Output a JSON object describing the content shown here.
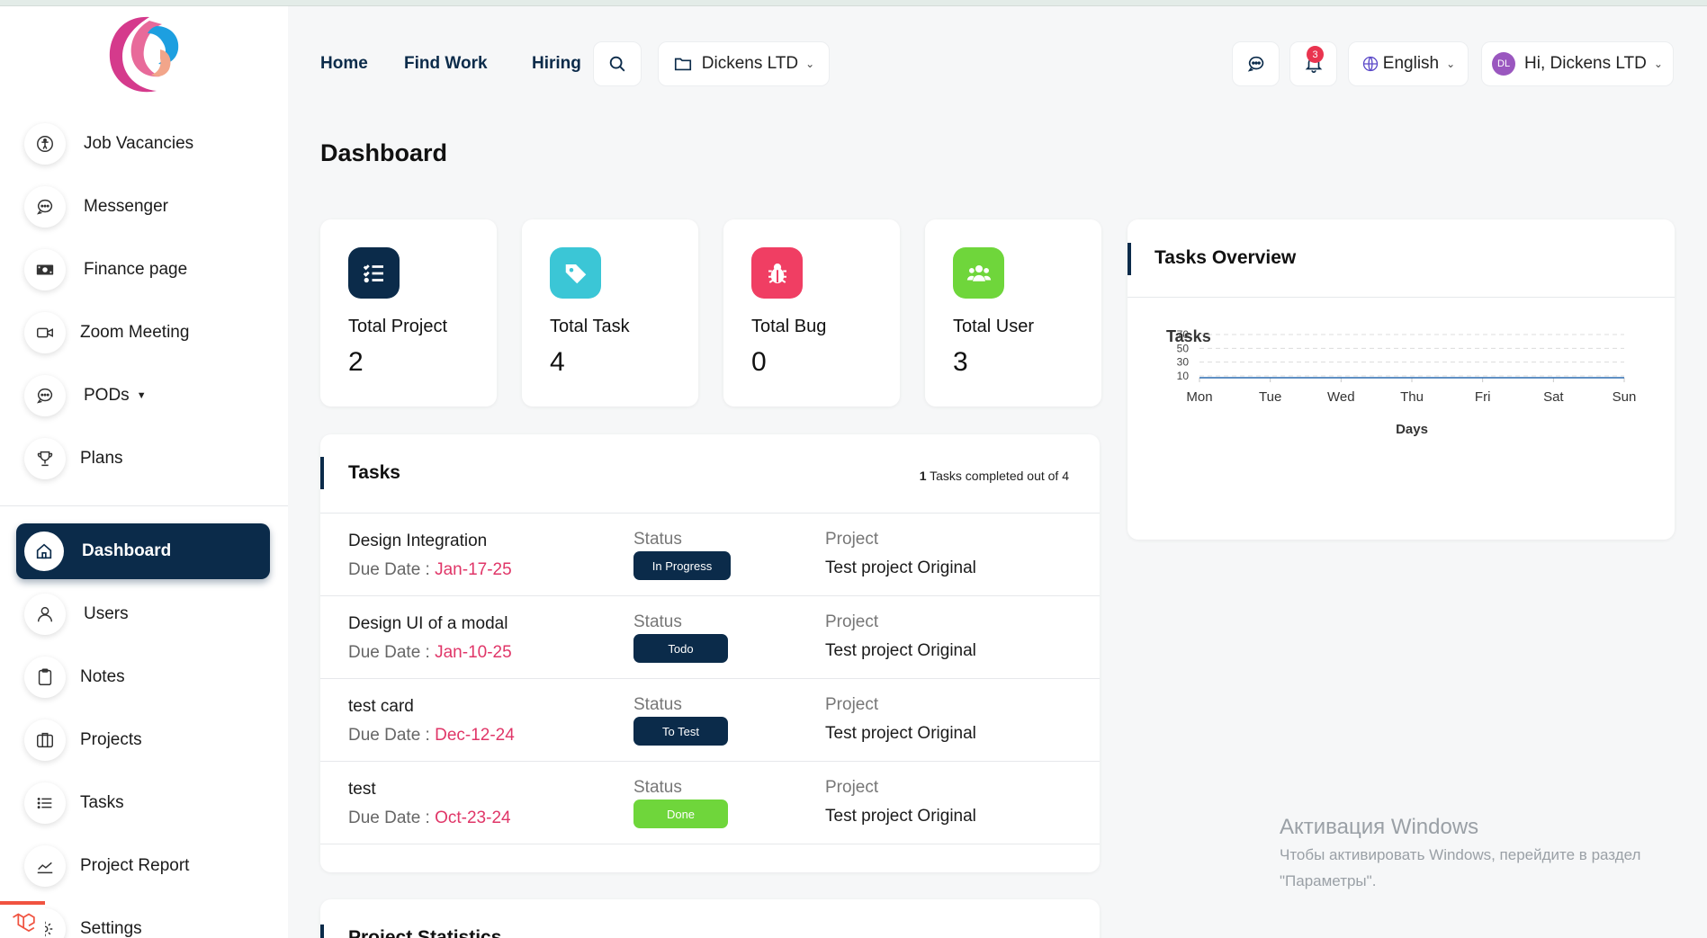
{
  "nav": {
    "home": "Home",
    "find_work": "Find Work",
    "hiring": "Hiring"
  },
  "header": {
    "workspace": "Dickens LTD",
    "notifications_count": "3",
    "language": "English",
    "user_initials": "DL",
    "greeting": "Hi, Dickens LTD"
  },
  "sidebar": {
    "items": [
      {
        "label": "Job Vacancies",
        "icon": "accessibility-icon"
      },
      {
        "label": "Messenger",
        "icon": "chat-icon"
      },
      {
        "label": "Finance page",
        "icon": "money-icon"
      },
      {
        "label": "Zoom Meeting",
        "icon": "video-icon"
      },
      {
        "label": "PODs",
        "icon": "chat-icon"
      },
      {
        "label": "Plans",
        "icon": "trophy-icon"
      },
      {
        "label": "Dashboard",
        "icon": "home-icon",
        "active": true
      },
      {
        "label": "Users",
        "icon": "user-icon"
      },
      {
        "label": "Notes",
        "icon": "clipboard-icon"
      },
      {
        "label": "Projects",
        "icon": "columns-icon"
      },
      {
        "label": "Tasks",
        "icon": "list-icon"
      },
      {
        "label": "Project Report",
        "icon": "chart-line-icon"
      },
      {
        "label": "Settings",
        "icon": "gear-icon"
      }
    ]
  },
  "page": {
    "title": "Dashboard"
  },
  "stats": [
    {
      "label": "Total Project",
      "value": "2",
      "color": "#0b2b4a",
      "icon": "checklist-icon"
    },
    {
      "label": "Total Task",
      "value": "4",
      "color": "#3bc6d6",
      "icon": "tag-icon"
    },
    {
      "label": "Total Bug",
      "value": "0",
      "color": "#f03e63",
      "icon": "bug-icon"
    },
    {
      "label": "Total User",
      "value": "3",
      "color": "#6fd63b",
      "icon": "users-icon"
    }
  ],
  "tasks_panel": {
    "title": "Tasks",
    "completed": "1",
    "summary_suffix": "Tasks completed out of 4",
    "status_label": "Status",
    "project_label": "Project",
    "due_label": "Due Date : ",
    "rows": [
      {
        "name": "Design Integration",
        "due": "Jan-17-25",
        "status": "In Progress",
        "status_color": "#0b2b4a",
        "project": "Test project Original"
      },
      {
        "name": "Design UI of a modal",
        "due": "Jan-10-25",
        "status": "Todo",
        "status_color": "#0b2b4a",
        "project": "Test project Original"
      },
      {
        "name": "test card",
        "due": "Dec-12-24",
        "status": "To Test",
        "status_color": "#0b2b4a",
        "project": "Test project Original"
      },
      {
        "name": "test",
        "due": "Oct-23-24",
        "status": "Done",
        "status_color": "#6fd63b",
        "project": "Test project Original"
      }
    ]
  },
  "project_statistics_panel": {
    "title": "Project Statistics"
  },
  "overview": {
    "title": "Tasks Overview"
  },
  "chart_data": {
    "type": "line",
    "title": "Tasks",
    "xlabel": "Days",
    "ylabel": "",
    "categories": [
      "Mon",
      "Tue",
      "Wed",
      "Thu",
      "Fri",
      "Sat",
      "Sun"
    ],
    "yticks": [
      "70",
      "50",
      "30",
      "10"
    ],
    "series": [
      {
        "values": [
          0,
          0,
          0,
          0,
          0,
          0,
          0
        ]
      }
    ],
    "grid": true
  },
  "watermark": {
    "title": "Активация Windows",
    "line1": "Чтобы активировать Windows, перейдите в раздел",
    "line2": "\"Параметры\"."
  }
}
